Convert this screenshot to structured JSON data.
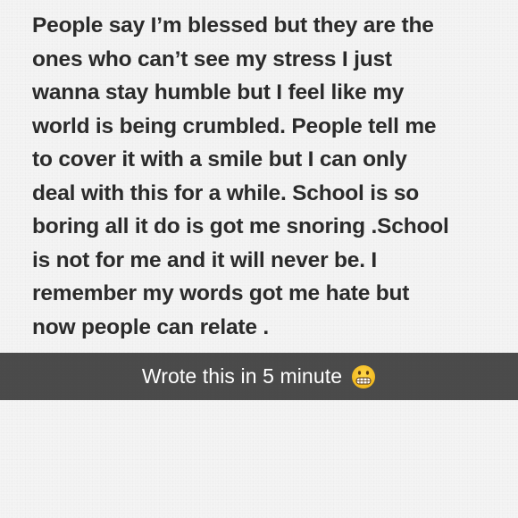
{
  "note": {
    "text": "People say I’m blessed but they are the\nones who can’t see my stress I just\nwanna stay humble but I feel like my\nworld is being crumbled. People tell me\nto cover it with a smile but I can only\ndeal with this for a while. School is so\nboring all it do is got me snoring .School\nis not for me and it will never be. I\nremember my words got me hate but\nnow people can relate ."
  },
  "caption": {
    "text": "Wrote this in 5 minute",
    "emoji": "grimacing-face-icon",
    "bar_color": "#3c3c3c"
  },
  "colors": {
    "background": "#f4f4f4",
    "text": "#2b2b2b",
    "caption_text": "#ffffff",
    "emoji_yellow": "#f5c21b"
  }
}
